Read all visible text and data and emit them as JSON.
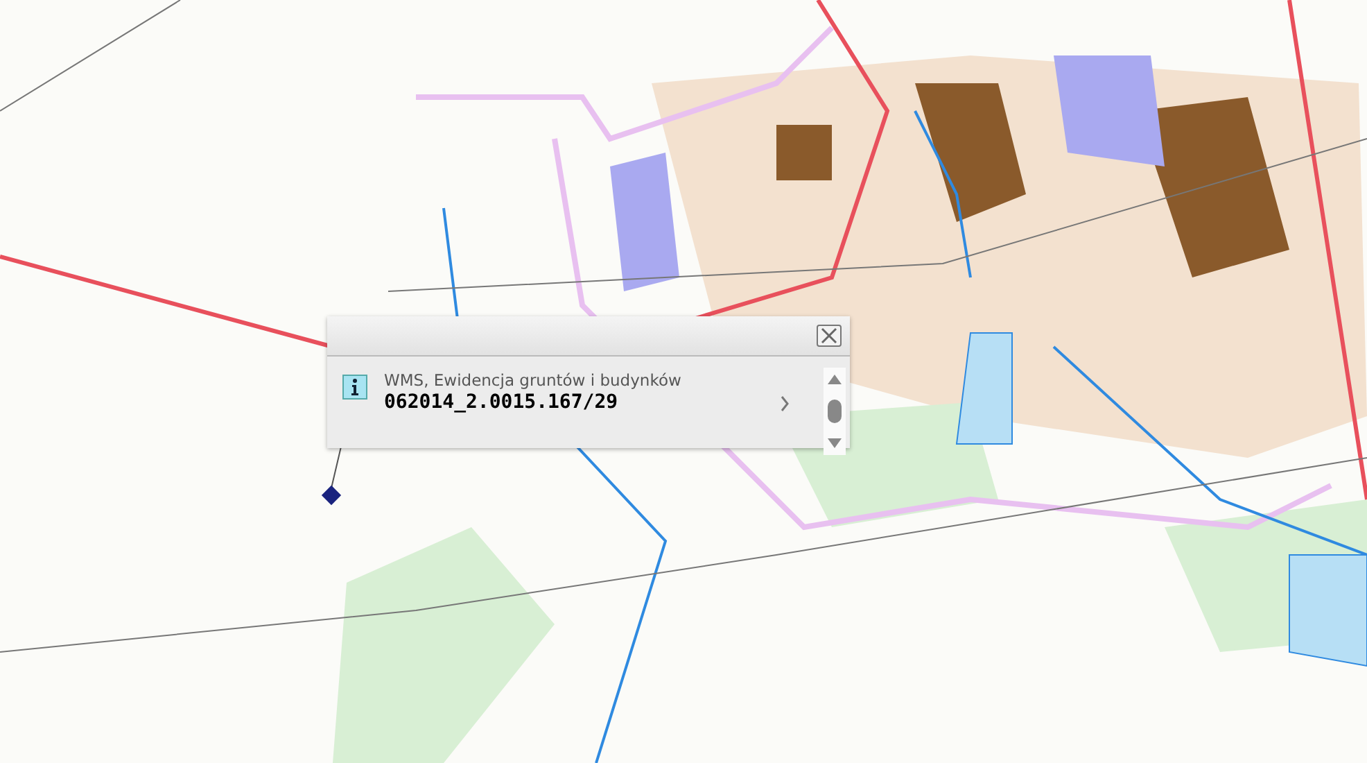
{
  "map": {
    "popup": {
      "title": "WMS, Ewidencja gruntów i budynków",
      "value": "062014_2.0015.167/29"
    }
  }
}
